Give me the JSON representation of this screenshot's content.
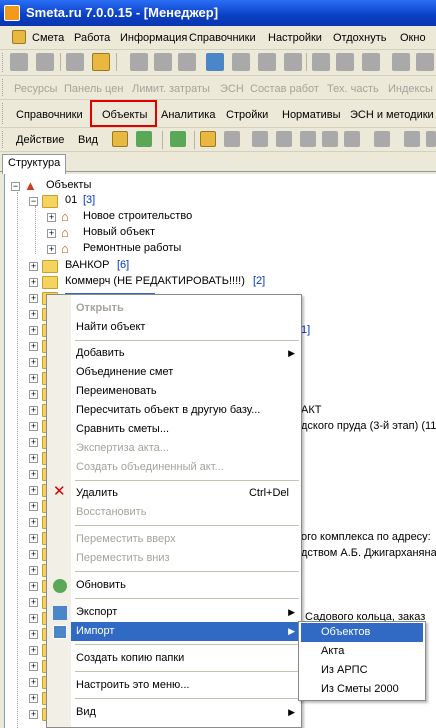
{
  "window": {
    "title": "Smeta.ru  7.0.0.15   - [Менеджер]"
  },
  "menubar": [
    "Смета",
    "Работа",
    "Информация",
    "Справочники",
    "Настройки",
    "Отдохнуть",
    "Окно"
  ],
  "toolbar2": [
    "Ресурсы",
    "Панель цен",
    "Лимит. затраты",
    "ЭСН",
    "Состав работ",
    "Тех. часть",
    "Индексы"
  ],
  "tabs": [
    "Справочники",
    "Объекты",
    "Аналитика",
    "Стройки",
    "Нормативы",
    "ЭСН и методики"
  ],
  "action_bar": {
    "action": "Действие",
    "view": "Вид"
  },
  "doc_tab": "Структура",
  "tree": {
    "root": "Объекты",
    "n01": "01",
    "n01_count": "[3]",
    "children": [
      "Новое строительство",
      "Новый объект",
      "Ремонтные работы"
    ],
    "vankor": "ВАНКОР",
    "vankor_count": "[6]",
    "kommerch": "Коммерч (НЕ РЕДАКТИРОВАТЬ!!!!)",
    "kommerch_count": "[2]",
    "bg": [
      "1]",
      "АКТ",
      "дского пруда (3-й этап) (11.",
      "ого комплекса по адресу:",
      "дством А.Б. Джигарханяна",
      "Садового кольца, заказ"
    ]
  },
  "context_menu": {
    "open": "Открыть",
    "find": "Найти объект",
    "add": "Добавить",
    "merge": "Объединение смет",
    "rename": "Переименовать",
    "recalc": "Пересчитать объект в другую базу...",
    "compare": "Сравнить сметы...",
    "expertise": "Экспертиза акта...",
    "create_act": "Создать объединенный акт...",
    "delete": "Удалить",
    "delete_shortcut": "Ctrl+Del",
    "restore": "Восстановить",
    "move_up": "Переместить вверх",
    "move_down": "Переместить вниз",
    "refresh": "Обновить",
    "export": "Экспорт",
    "import": "Импорт",
    "copy_folder": "Создать копию папки",
    "configure": "Настроить это меню...",
    "view": "Вид"
  },
  "submenu": [
    "Объектов",
    "Акта",
    "Из АРПС",
    "Из Сметы 2000"
  ],
  "colors": {
    "title": "#0a3fc4",
    "selection": "#316ac5",
    "highlight_box": "#e10000"
  }
}
